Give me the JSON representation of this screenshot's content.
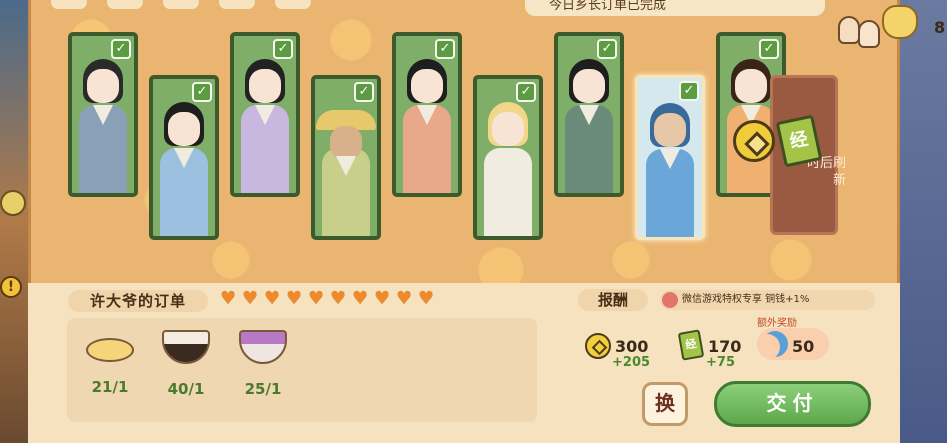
{
  "header": {
    "notice": "今日乡长订单已完成",
    "currency_value": "8"
  },
  "customers": [
    {
      "id": "c1",
      "checked": true,
      "selected": false
    },
    {
      "id": "c2",
      "checked": true,
      "selected": false
    },
    {
      "id": "c3",
      "checked": true,
      "selected": false
    },
    {
      "id": "c4",
      "checked": true,
      "selected": false
    },
    {
      "id": "c5",
      "checked": true,
      "selected": false
    },
    {
      "id": "c6",
      "checked": true,
      "selected": false
    },
    {
      "id": "c7",
      "checked": true,
      "selected": false
    },
    {
      "id": "c8",
      "checked": true,
      "selected": true
    },
    {
      "id": "c9",
      "checked": true,
      "selected": false
    }
  ],
  "refresh_card": {
    "text": "时后刷新"
  },
  "order": {
    "title": "许大爷的订单",
    "hearts_count": 10,
    "items": [
      {
        "icon": "flatbread-icon",
        "count": "21/1"
      },
      {
        "icon": "rice-bowl-icon",
        "count": "40/1"
      },
      {
        "icon": "purple-porridge-icon",
        "count": "25/1"
      }
    ]
  },
  "reward": {
    "title": "报酬",
    "bonus_note": "微信游戏特权专享 铜钱+1%",
    "extra_label": "额外奖励",
    "coins": {
      "value": "300",
      "plus": "+205"
    },
    "books": {
      "value": "170",
      "plus": "+75",
      "glyph": "经"
    },
    "moon": {
      "value": "50"
    }
  },
  "buttons": {
    "swap": "换",
    "submit": "交付"
  },
  "card_icons": {
    "book_glyph": "经"
  }
}
